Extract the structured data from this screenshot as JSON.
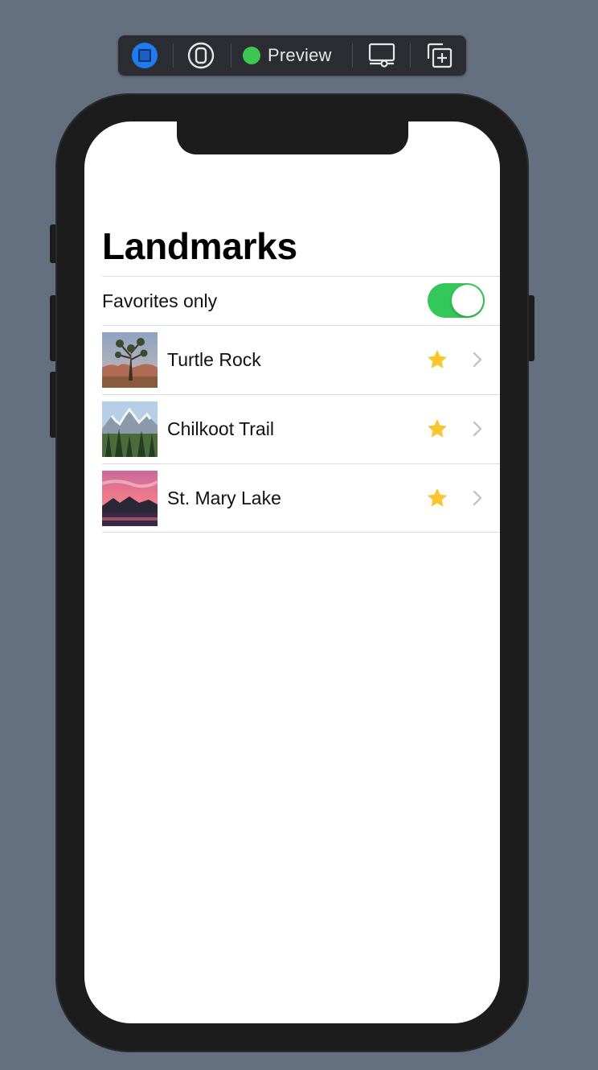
{
  "toolbar": {
    "preview_label": "Preview",
    "icons": [
      "live-preview-icon",
      "device-icon",
      "device-settings-icon",
      "duplicate-preview-icon"
    ],
    "status_color": "#3dc651",
    "accent_color": "#1f7bf0"
  },
  "screen": {
    "title": "Landmarks",
    "favorites_toggle": {
      "label": "Favorites only",
      "on": true,
      "color": "#34c759"
    },
    "landmarks": [
      {
        "name": "Turtle Rock",
        "favorite": true
      },
      {
        "name": "Chilkoot Trail",
        "favorite": true
      },
      {
        "name": "St. Mary Lake",
        "favorite": true
      }
    ],
    "star_color": "#f9c62d"
  }
}
